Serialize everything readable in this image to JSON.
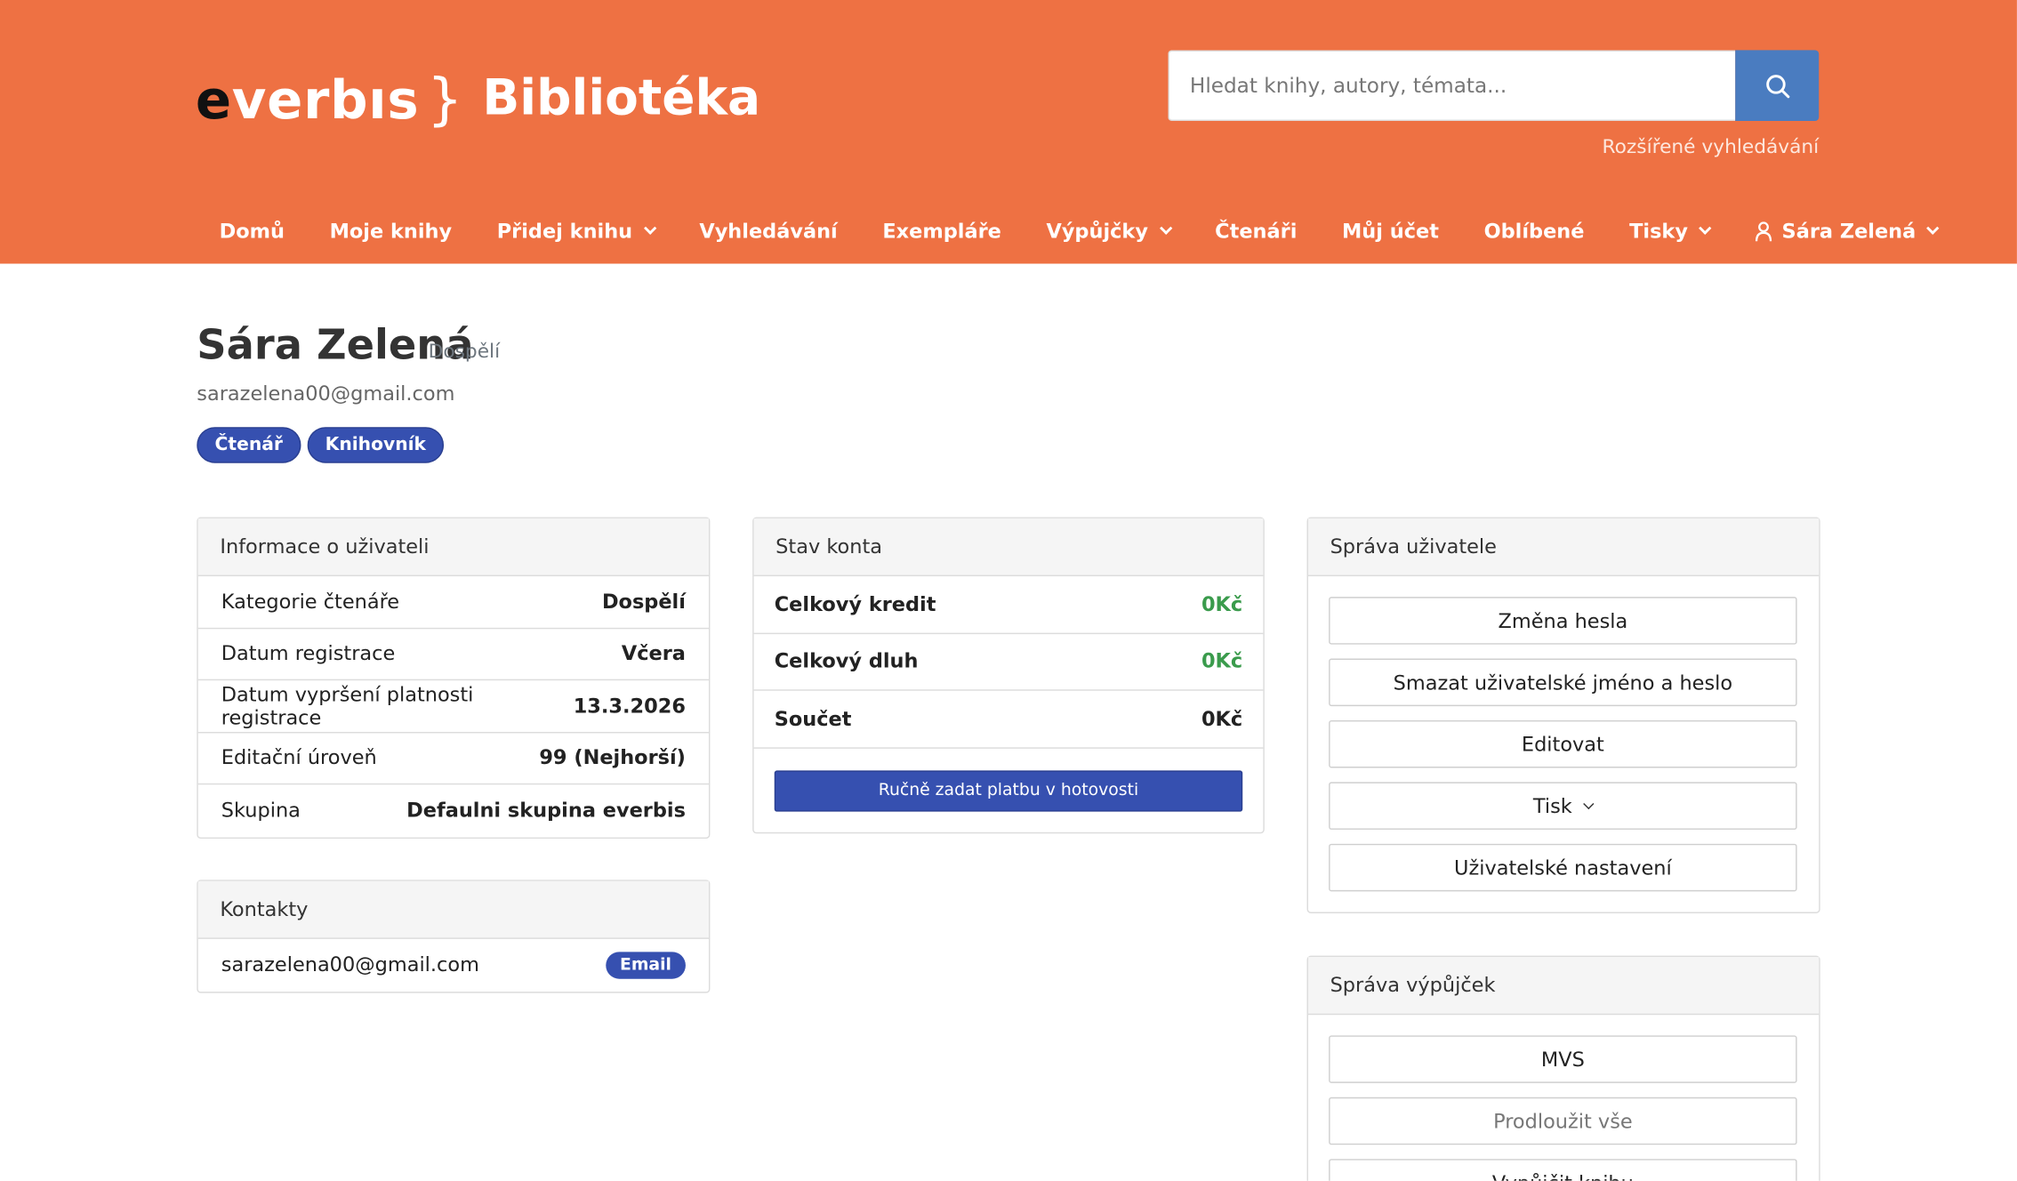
{
  "header": {
    "logo": {
      "e": "e",
      "rest": "verbıs",
      "brace": "}"
    },
    "title": "Bibliotéka",
    "search": {
      "placeholder": "Hledat knihy, autory, témata..."
    },
    "advanced_search": "Rozšířené vyhledávání",
    "nav": [
      {
        "label": "Domů",
        "dropdown": false
      },
      {
        "label": "Moje knihy",
        "dropdown": false
      },
      {
        "label": "Přidej knihu",
        "dropdown": true
      },
      {
        "label": "Vyhledávání",
        "dropdown": false
      },
      {
        "label": "Exempláře",
        "dropdown": false
      },
      {
        "label": "Výpůjčky",
        "dropdown": true
      },
      {
        "label": "Čtenáři",
        "dropdown": false
      },
      {
        "label": "Můj účet",
        "dropdown": false
      },
      {
        "label": "Oblíbené",
        "dropdown": false
      },
      {
        "label": "Tisky",
        "dropdown": true
      }
    ],
    "user_menu": "Sára Zelená"
  },
  "profile": {
    "name": "Sára Zelená",
    "category": "Dospělí",
    "email": "sarazelena00@gmail.com",
    "roles": [
      "Čtenář",
      "Knihovník"
    ]
  },
  "user_info": {
    "title": "Informace o uživateli",
    "rows": [
      {
        "label": "Kategorie čtenáře",
        "value": "Dospělí"
      },
      {
        "label": "Datum registrace",
        "value": "Včera"
      },
      {
        "label": "Datum vypršení platnosti registrace",
        "value": "13.3.2026"
      },
      {
        "label": "Editační úroveň",
        "value": "99 (Nejhorší)"
      },
      {
        "label": "Skupina",
        "value": "Defaulni skupina everbis"
      }
    ]
  },
  "contacts": {
    "title": "Kontakty",
    "items": [
      {
        "value": "sarazelena00@gmail.com",
        "type": "Email"
      }
    ]
  },
  "account": {
    "title": "Stav konta",
    "rows": [
      {
        "label": "Celkový kredit",
        "value": "0Kč",
        "color": "#3a9b4c"
      },
      {
        "label": "Celkový dluh",
        "value": "0Kč",
        "color": "#3a9b4c"
      },
      {
        "label": "Součet",
        "value": "0Kč",
        "color": "#222222"
      }
    ],
    "cash_button": "Ručně zadat platbu v hotovosti"
  },
  "user_mgmt": {
    "title": "Správa uživatele",
    "buttons": [
      "Změna hesla",
      "Smazat uživatelské jméno a heslo",
      "Editovat",
      "Tisk",
      "Uživatelské nastavení"
    ]
  },
  "loan_mgmt": {
    "title": "Správa výpůjček",
    "buttons": [
      "MVS",
      "Prodloužit vše",
      "Vypůjčit knihu"
    ]
  },
  "colors": {
    "header": "#ee7143",
    "accent": "#3650b0",
    "search_button": "#4a7cc0",
    "positive": "#3a9b4c"
  }
}
